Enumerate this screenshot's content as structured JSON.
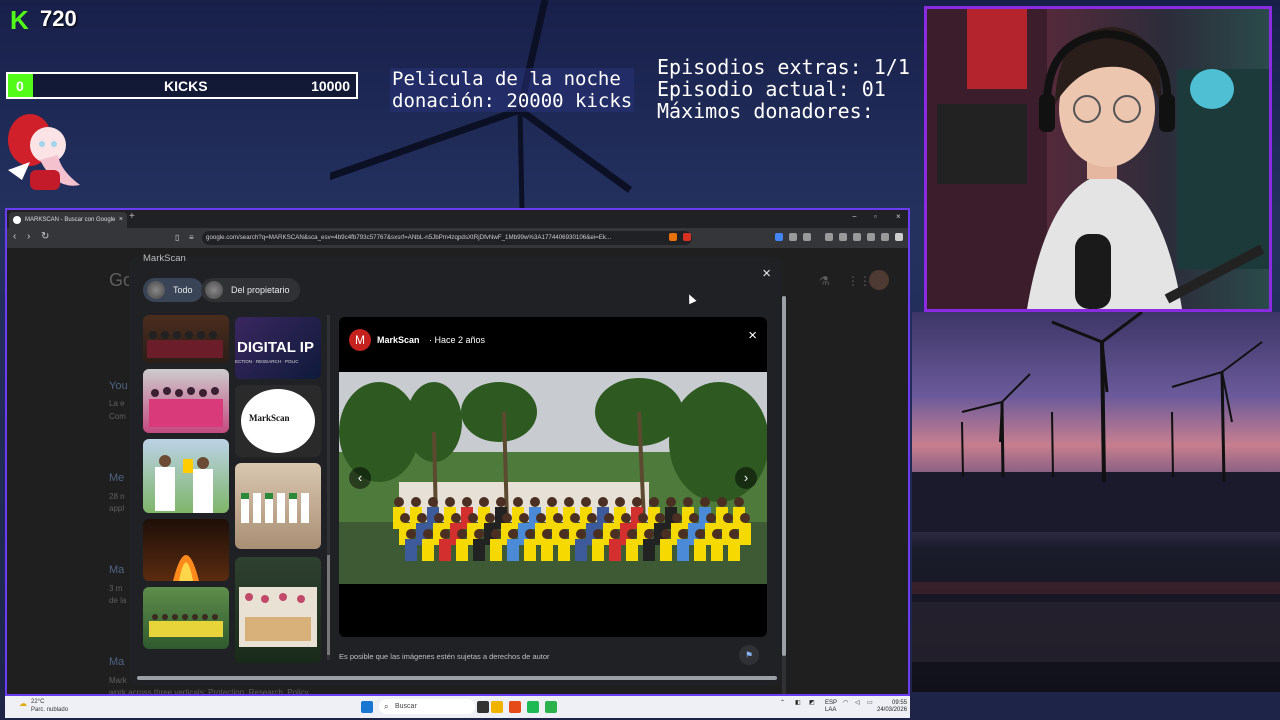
{
  "overlay": {
    "kick_count": "720",
    "kicks_bar": {
      "min": "0",
      "label": "KICKS",
      "max": "10000",
      "progress_fraction": 0.072
    },
    "movie_goal_line1": "Pelicula de la noche",
    "movie_goal_line2": "donación: 20000 kicks",
    "episodes_extra": "Episodios extras: 1/1",
    "episode_current": "Episodio actual: 01",
    "top_donors": "Máximos donadores:"
  },
  "browser": {
    "tab_title": "MARKSCAN - Buscar con Google",
    "tab_close": "×",
    "new_tab": "+",
    "url": "google.com/search?q=MARKSCAN&sca_esv=4b9c4fb793c57767&sxsrf=ANbL-n5JbPm4zqpdsXtRjDfvNwF_1Mb99w%3A1774406930106&ei=Ek...",
    "window_controls": [
      "−",
      "▫",
      "×"
    ],
    "background_text": [
      "Go",
      "You",
      "La e",
      "Com",
      "Me",
      "28 n",
      "appl",
      "Ma",
      "3 m",
      "de la",
      "Ma",
      "Mark"
    ],
    "background_footer": "work across three verticals: Protection, Research, Policy..."
  },
  "modal": {
    "title": "MarkScan",
    "chips": [
      "Todo",
      "Del propietario"
    ],
    "close": "×",
    "thumb_digital_text": "DIGITAL IP",
    "thumb_digital_sub": "ECTION · RESEARCH · POLIC",
    "thumb_logo_text": "MarkScan",
    "viewer": {
      "avatar_letter": "M",
      "source": "MarkScan",
      "time": "· Hace 2 años",
      "close": "×",
      "prev": "‹",
      "next": "›"
    },
    "copyright": "Es posible que las imágenes estén sujetas a derechos de autor",
    "flag_icon": "⚑"
  },
  "taskbar": {
    "weather_temp": "22°C",
    "weather_desc": "Parc. nublado",
    "search_placeholder": "Buscar",
    "lang_top": "ESP",
    "lang_bottom": "LAA",
    "time": "09:55",
    "date": "24/03/2026"
  },
  "colors": {
    "kick_green": "#53fc18",
    "frame_purple": "#8a2be2",
    "chip_active": "#394457"
  }
}
